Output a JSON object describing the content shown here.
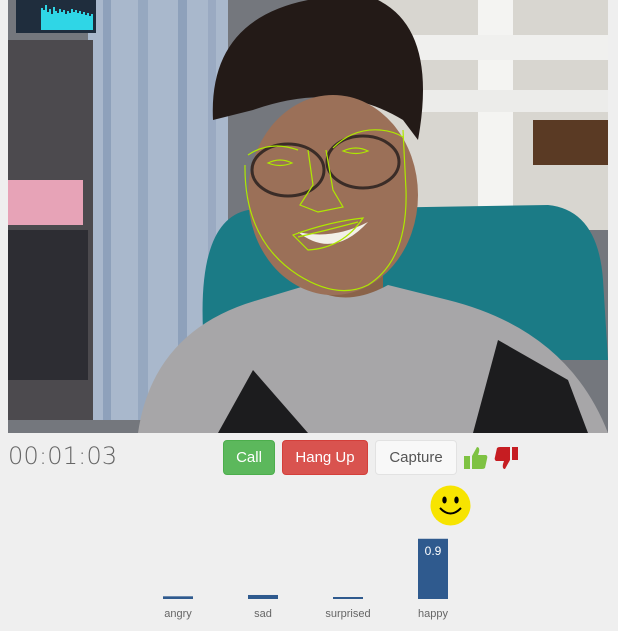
{
  "timer": "00:01:03",
  "buttons": {
    "call": "Call",
    "hang_up": "Hang Up",
    "capture": "Capture"
  },
  "icons": {
    "thumbs_up": "thumbs-up-icon",
    "thumbs_down": "thumbs-down-icon",
    "emotion": "smiley-face-icon"
  },
  "colors": {
    "call": "#5cb85c",
    "hang_up": "#d9534f",
    "bar": "#2f5a8e",
    "thumb_up": "#7ec242",
    "thumb_down": "#c61d22",
    "smiley": "#f7e400"
  },
  "chart_data": {
    "type": "bar",
    "categories": [
      "angry",
      "sad",
      "surprised",
      "happy"
    ],
    "values": [
      0.04,
      0.06,
      0.01,
      0.9
    ],
    "data_labels": [
      "",
      "",
      "",
      "0.9"
    ],
    "ylim": [
      0,
      1
    ]
  }
}
